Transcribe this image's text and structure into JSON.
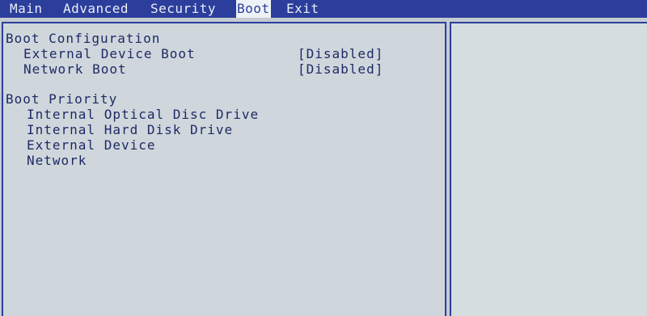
{
  "menu": {
    "tabs": [
      "Main",
      "Advanced",
      "Security",
      "Boot",
      "Exit"
    ],
    "active": "Boot"
  },
  "boot_configuration": {
    "heading": "Boot Configuration",
    "items": [
      {
        "label": "External Device Boot",
        "value": "[Disabled]"
      },
      {
        "label": "Network Boot",
        "value": "[Disabled]"
      }
    ]
  },
  "boot_priority": {
    "heading": "Boot Priority",
    "items": [
      "Internal Optical Disc Drive",
      "Internal Hard Disk Drive",
      "External Device",
      "Network"
    ]
  },
  "colors": {
    "menu_bar": "#2c3e9c",
    "background": "#c4ccd0",
    "text": "#1f2a66"
  }
}
